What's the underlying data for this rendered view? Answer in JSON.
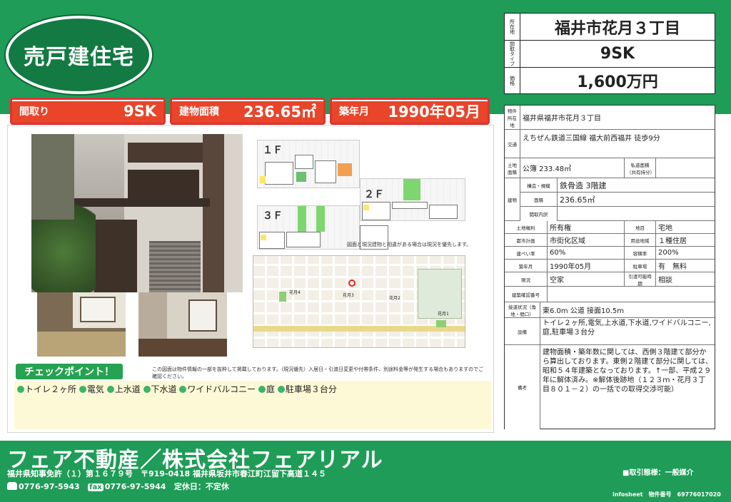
{
  "listing_type": "売戸建住宅",
  "keys": [
    {
      "label": "間取り",
      "value": "9SK"
    },
    {
      "label": "建物面積",
      "value": "236.65㎡"
    },
    {
      "label": "築年月",
      "value": "1990年05月"
    }
  ],
  "header": {
    "location_label": "所在地",
    "location": "福井市花月３丁目",
    "type_label": "間取タイプ",
    "type": "9SK",
    "price_label": "価格",
    "price": "1,600万円"
  },
  "plans": {
    "f1": "１Ｆ",
    "f2": "２Ｆ",
    "f3": "３Ｆ",
    "note": "図面と現況建物と相違がある場合は現況を優先します。"
  },
  "map": {
    "labels": [
      "花月4",
      "花月3",
      "花月2",
      "花月1"
    ]
  },
  "disclaimer": "この図面は物件情報の一部を抜粋して掲載しております。（現況優先）入居日・引渡日変更や付帯条件、別途料金等が発生する場合もありますのでご確認ください。",
  "check": {
    "title": "チェックポイント！",
    "items": [
      "トイレ２ヶ所",
      "電気",
      "上水道",
      "下水道",
      "ワイドバルコニー",
      "庭",
      "駐車場３台分"
    ]
  },
  "spec": {
    "address_label": "物件所在地",
    "address": "福井県福井市花月３丁目",
    "traffic_label": "交通",
    "traffic": "えちぜん鉄道三国線 福大前西福井 徒歩9分",
    "land_label": "土地面積",
    "land": "公簿 233.48㎡",
    "private_road_label": "私道面積（共有持分）",
    "building_label": "建物",
    "structure_label": "構造・規模",
    "structure": "鉄骨造 3階建",
    "floor_area_label": "面積",
    "floor_area": "236.65㎡",
    "mgmt_label": "閲取内訳",
    "rights_label": "土地権利",
    "rights": "所有権",
    "landcat_label": "地目",
    "landcat": "宅地",
    "city_label": "都市計画",
    "city": "市街化区域",
    "zone_label": "用途地域",
    "zone": "１種住居",
    "bcr_label": "建ぺい率",
    "bcr": "60%",
    "far_label": "容積率",
    "far": "200%",
    "built_label": "築年月",
    "built": "1990年05月",
    "parking_label": "駐車場",
    "parking": "有　無料",
    "status_label": "現況",
    "status": "空家",
    "handover_label": "引渡可能時期",
    "handover": "相談",
    "cert_label": "建築確認番号",
    "road_label": "接道状況（角地・間口）",
    "road": "東6.0m 公道 接面10.5m",
    "equip_label": "設備",
    "equip": "トイレ２ヶ所,電気,上水道,下水道,ワイドバルコニー,庭,駐車場３台分",
    "remarks_label": "備考",
    "remarks": "建物面積・築年数に関しては、西側３階建て部分から算出しております。東側２階建て部分に関しては、昭和５４年建築となっております。↑一部、平成２９年に解体済み。※解体後跡地（１２３ｍ・花月３丁目８０１－２）の一括での取得交渉可能）"
  },
  "footer": {
    "company": "フェア不動産／株式会社フェアリアル",
    "license": "福井県知事免許（１）第１６７９号　〒919-0418 福井県坂井市春江町江留下高道１４５",
    "tel": "0776-97-5943",
    "fax_label": "fax",
    "fax": "0776-97-5944",
    "holiday": "定休日：不定休",
    "deal": "■取引態様：一般媒介",
    "info": "infosheet　物件番号　69776017020"
  },
  "colors": {
    "brand": "#1f9c57",
    "accent": "#e8452a",
    "note_bg": "#fdf9d6"
  }
}
